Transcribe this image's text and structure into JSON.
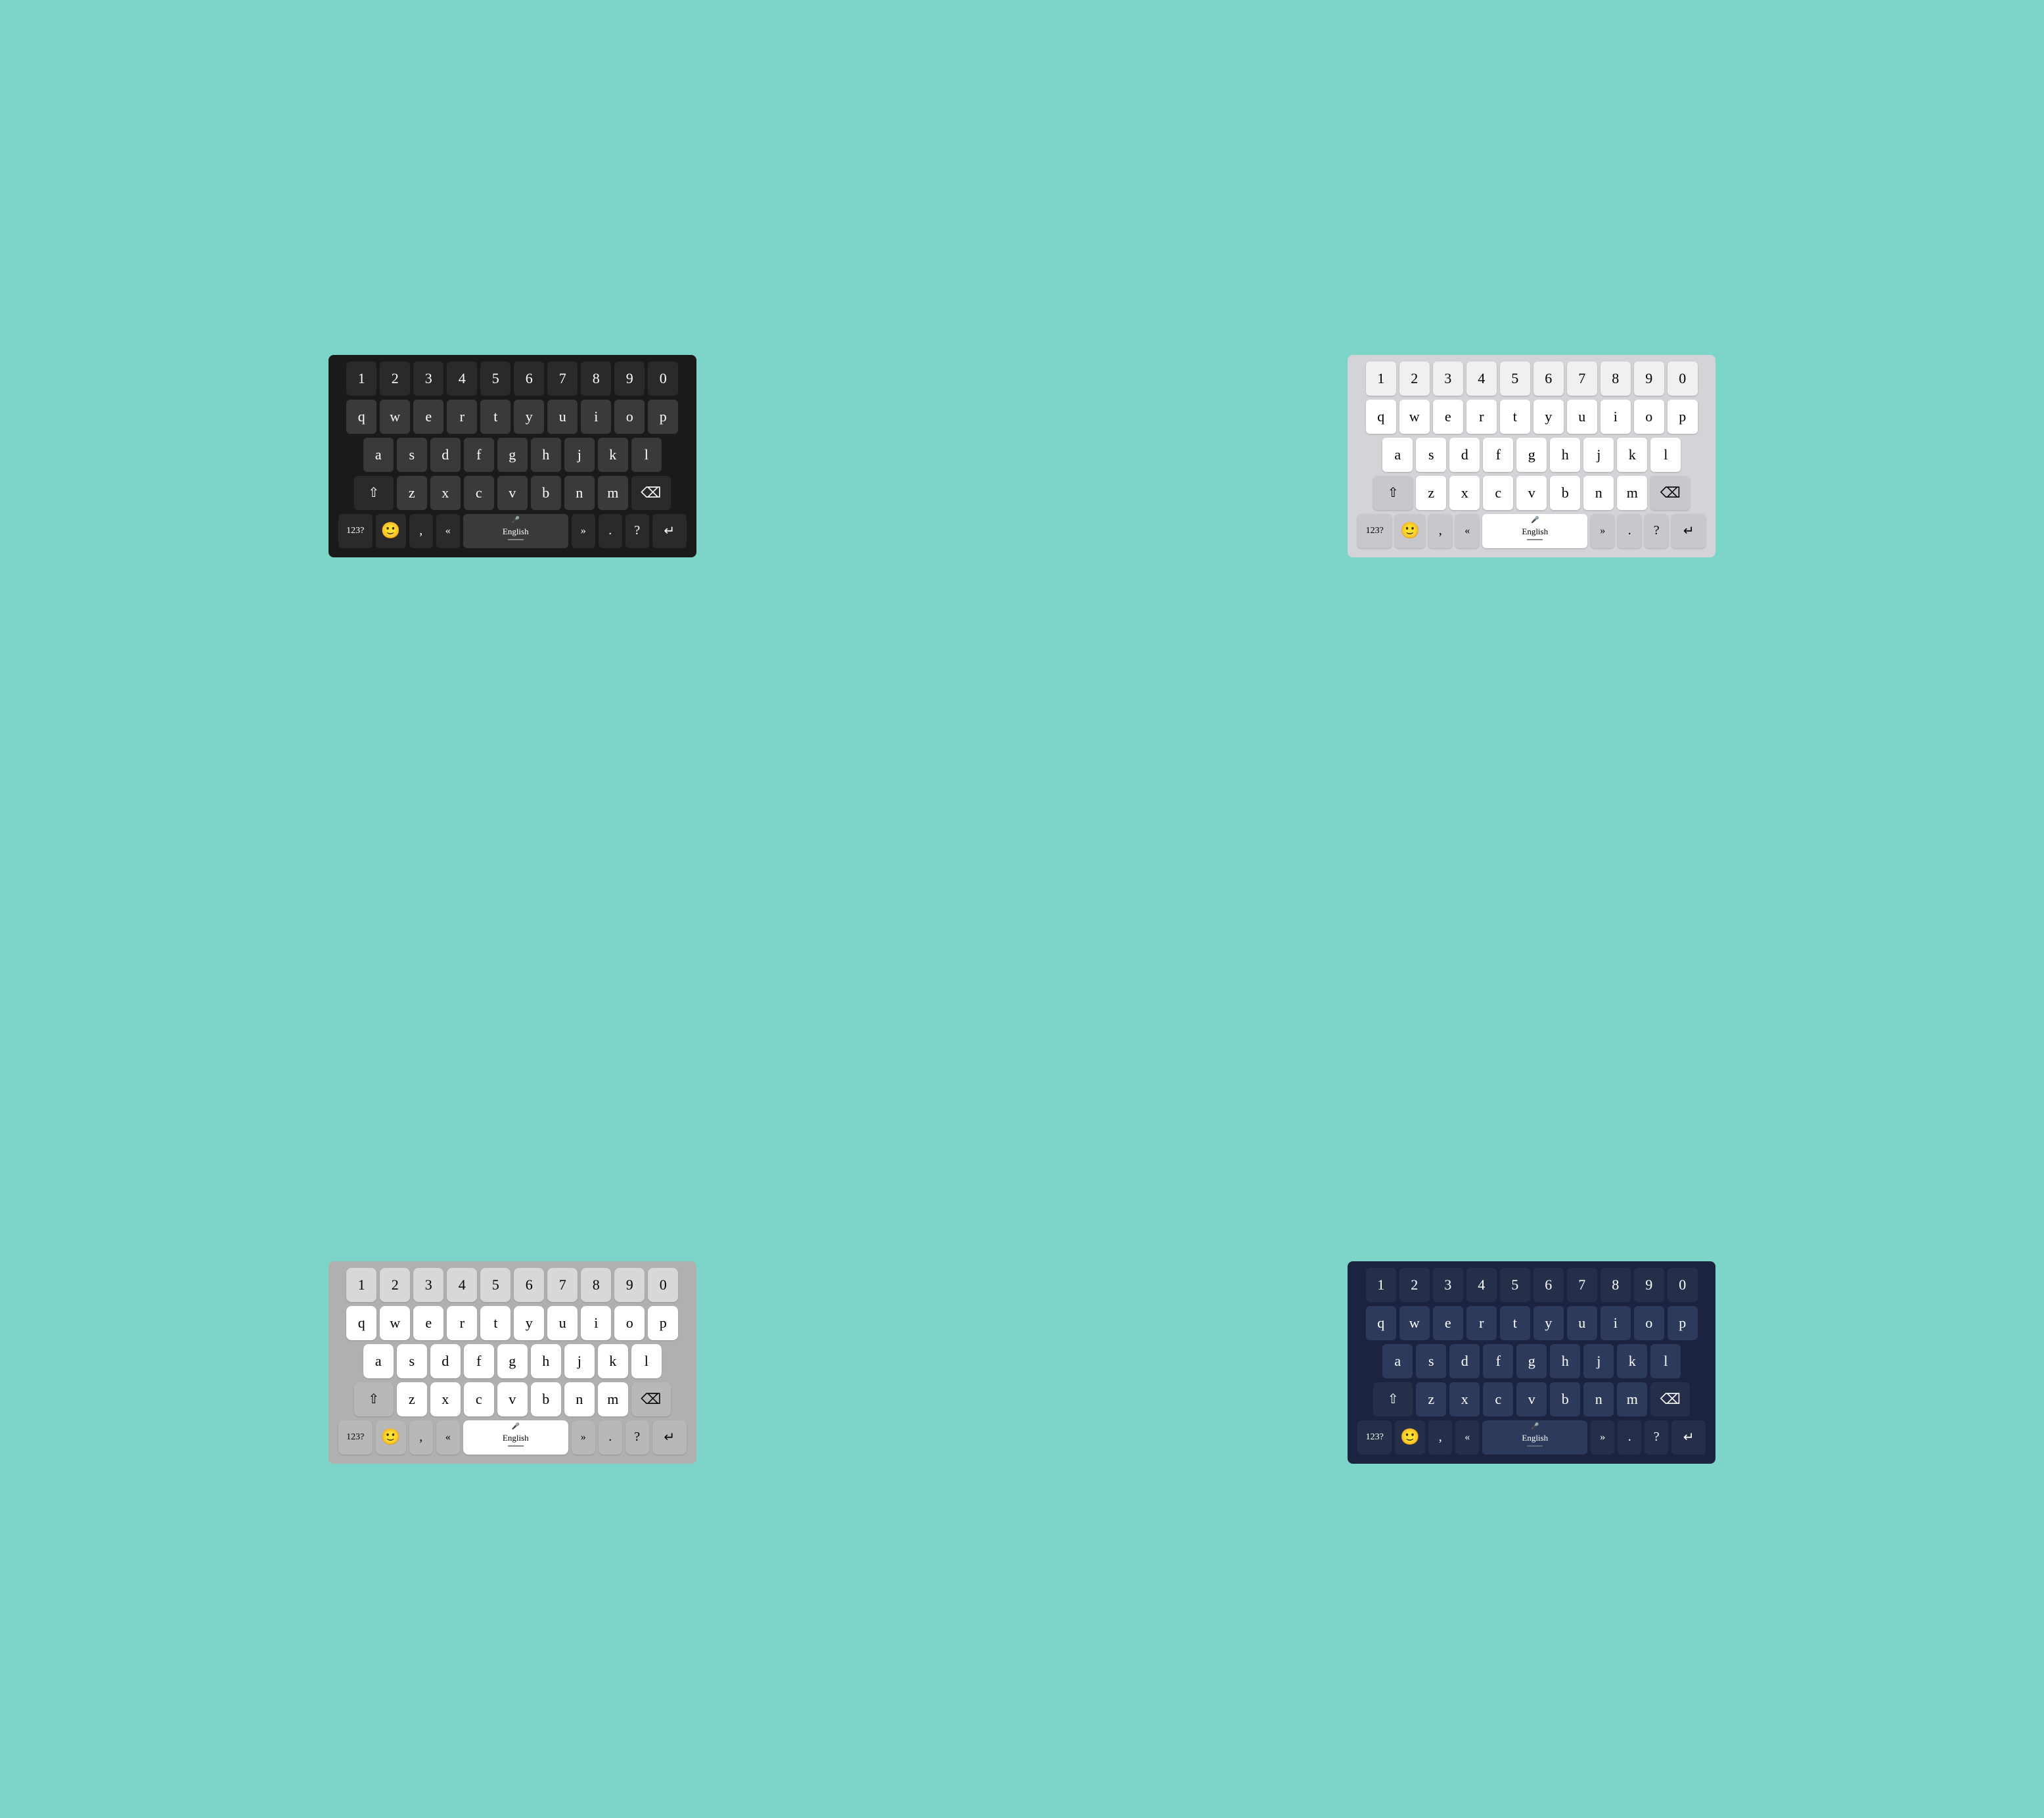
{
  "keyboards": [
    {
      "id": "dark",
      "theme": "theme-dark",
      "rows": {
        "numbers": [
          "1",
          "2",
          "3",
          "4",
          "5",
          "6",
          "7",
          "8",
          "9",
          "0"
        ],
        "row1": [
          "q",
          "w",
          "e",
          "r",
          "t",
          "y",
          "u",
          "i",
          "o",
          "p"
        ],
        "row2": [
          "a",
          "s",
          "d",
          "f",
          "g",
          "h",
          "j",
          "k",
          "l"
        ],
        "row3": [
          "z",
          "x",
          "c",
          "v",
          "b",
          "n",
          "m"
        ],
        "bottom": {
          "num": "123?",
          "emoji": "🙂",
          "comma": ",",
          "arrowLeft": "«",
          "lang": "English",
          "arrowRight": "»",
          "period": ".",
          "question": "?",
          "enter": "↵"
        }
      }
    },
    {
      "id": "light",
      "theme": "theme-light",
      "rows": {
        "numbers": [
          "1",
          "2",
          "3",
          "4",
          "5",
          "6",
          "7",
          "8",
          "9",
          "0"
        ],
        "row1": [
          "q",
          "w",
          "e",
          "r",
          "t",
          "y",
          "u",
          "i",
          "o",
          "p"
        ],
        "row2": [
          "a",
          "s",
          "d",
          "f",
          "g",
          "h",
          "j",
          "k",
          "l"
        ],
        "row3": [
          "z",
          "x",
          "c",
          "v",
          "b",
          "n",
          "m"
        ],
        "bottom": {
          "num": "123?",
          "emoji": "🙂",
          "comma": ",",
          "arrowLeft": "«",
          "lang": "English",
          "arrowRight": "»",
          "period": ".",
          "question": "?",
          "enter": "↵"
        }
      }
    },
    {
      "id": "gray",
      "theme": "theme-gray",
      "rows": {
        "numbers": [
          "1",
          "2",
          "3",
          "4",
          "5",
          "6",
          "7",
          "8",
          "9",
          "0"
        ],
        "row1": [
          "q",
          "w",
          "e",
          "r",
          "t",
          "y",
          "u",
          "i",
          "o",
          "p"
        ],
        "row2": [
          "a",
          "s",
          "d",
          "f",
          "g",
          "h",
          "j",
          "k",
          "l"
        ],
        "row3": [
          "z",
          "x",
          "c",
          "v",
          "b",
          "n",
          "m"
        ],
        "bottom": {
          "num": "123?",
          "emoji": "🙂",
          "comma": ",",
          "arrowLeft": "«",
          "lang": "English",
          "arrowRight": "»",
          "period": ".",
          "question": "?",
          "enter": "↵"
        }
      }
    },
    {
      "id": "navy",
      "theme": "theme-navy",
      "rows": {
        "numbers": [
          "1",
          "2",
          "3",
          "4",
          "5",
          "6",
          "7",
          "8",
          "9",
          "0"
        ],
        "row1": [
          "q",
          "w",
          "e",
          "r",
          "t",
          "y",
          "u",
          "i",
          "o",
          "p"
        ],
        "row2": [
          "a",
          "s",
          "d",
          "f",
          "g",
          "h",
          "j",
          "k",
          "l"
        ],
        "row3": [
          "z",
          "x",
          "c",
          "v",
          "b",
          "n",
          "m"
        ],
        "bottom": {
          "num": "123?",
          "emoji": "🙂",
          "comma": ",",
          "arrowLeft": "«",
          "lang": "English",
          "arrowRight": "»",
          "period": ".",
          "question": "?",
          "enter": "↵"
        }
      }
    }
  ]
}
